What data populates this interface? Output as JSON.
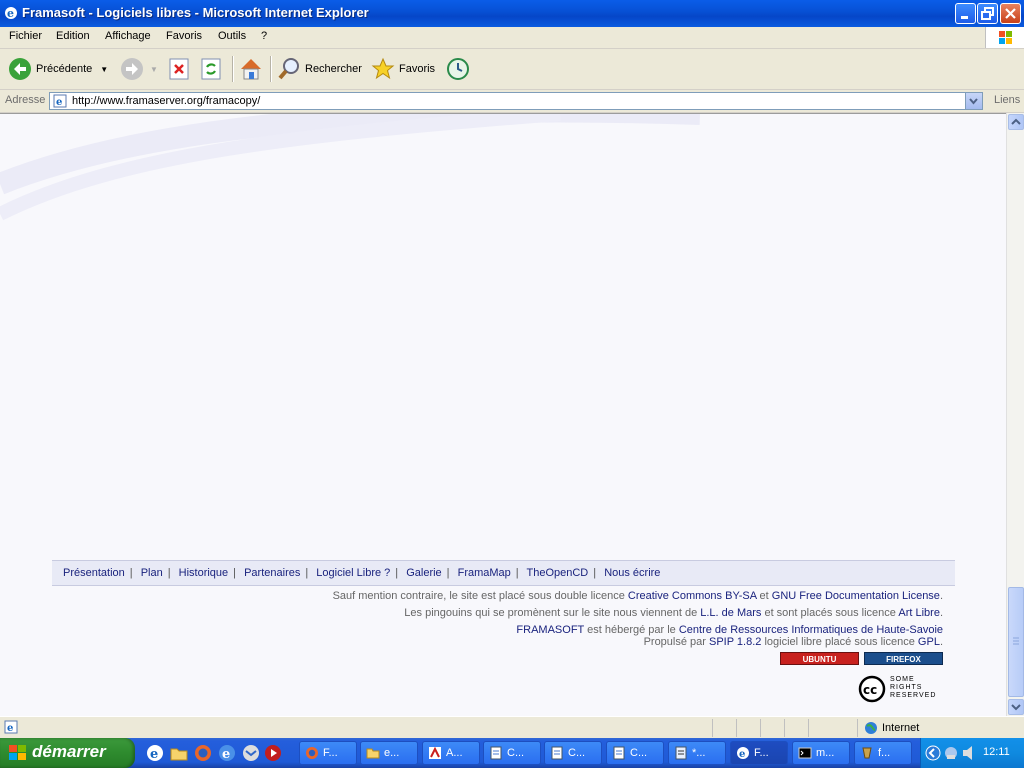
{
  "window": {
    "title": "Framasoft - Logiciels libres - Microsoft Internet Explorer"
  },
  "menu": {
    "items": [
      "Fichier",
      "Edition",
      "Affichage",
      "Favoris",
      "Outils",
      "?"
    ]
  },
  "toolbar": {
    "back_label": "Précédente",
    "search_label": "Rechercher",
    "favorites_label": "Favoris"
  },
  "address": {
    "label": "Adresse",
    "url": "http://www.framaserver.org/framacopy/",
    "links_label": "Liens"
  },
  "footer": {
    "nav": [
      "Présentation",
      "Plan",
      "Historique",
      "Partenaires",
      "Logiciel Libre ?",
      "Galerie",
      "FramaMap",
      "TheOpenCD",
      "Nous écrire"
    ],
    "license": {
      "prefix": "Sauf mention contraire, le site est placé sous double licence ",
      "link1": "Creative Commons BY-SA",
      "mid": " et ",
      "link2": "GNU Free Documentation License",
      "suffix": "."
    },
    "penguins": {
      "prefix": "Les pingouins qui se promènent sur le site nous viennent de ",
      "link1": "L.L. de Mars",
      "mid": " et sont placés sous licence ",
      "link2": "Art Libre",
      "suffix": "."
    },
    "hosting": {
      "link1": "FRAMASOFT",
      "mid": " est hébergé par le ",
      "link2": "Centre de Ressources Informatiques de Haute-Savoie"
    },
    "powered": {
      "prefix": "Propulsé par ",
      "link1": "SPIP 1.8.2",
      "mid": " logiciel libre placé sous licence ",
      "link2": "GPL",
      "suffix": "."
    },
    "badges": [
      "UBUNTU",
      "FIREFOX"
    ],
    "cc_lines": [
      "SOME",
      "RIGHTS",
      "RESERVED"
    ]
  },
  "status": {
    "zone": "Internet"
  },
  "taskbar": {
    "start_label": "démarrer",
    "tasks": [
      {
        "label": "F...",
        "icon": "firefox-icon"
      },
      {
        "label": "e...",
        "icon": "folder-icon"
      },
      {
        "label": "A...",
        "icon": "acrobat-icon"
      },
      {
        "label": "C...",
        "icon": "document-icon"
      },
      {
        "label": "C...",
        "icon": "document-icon"
      },
      {
        "label": "C...",
        "icon": "document-icon"
      },
      {
        "label": "*...",
        "icon": "notepad-icon"
      },
      {
        "label": "F...",
        "icon": "ie-icon"
      },
      {
        "label": "m...",
        "icon": "console-icon"
      },
      {
        "label": "f...",
        "icon": "app-icon"
      }
    ],
    "clock": "12:11"
  },
  "colors": {
    "link": "#1a237e",
    "content_bg": "#f8f8fc",
    "taskbar": "#245edc",
    "start": "#2e8b2e"
  }
}
